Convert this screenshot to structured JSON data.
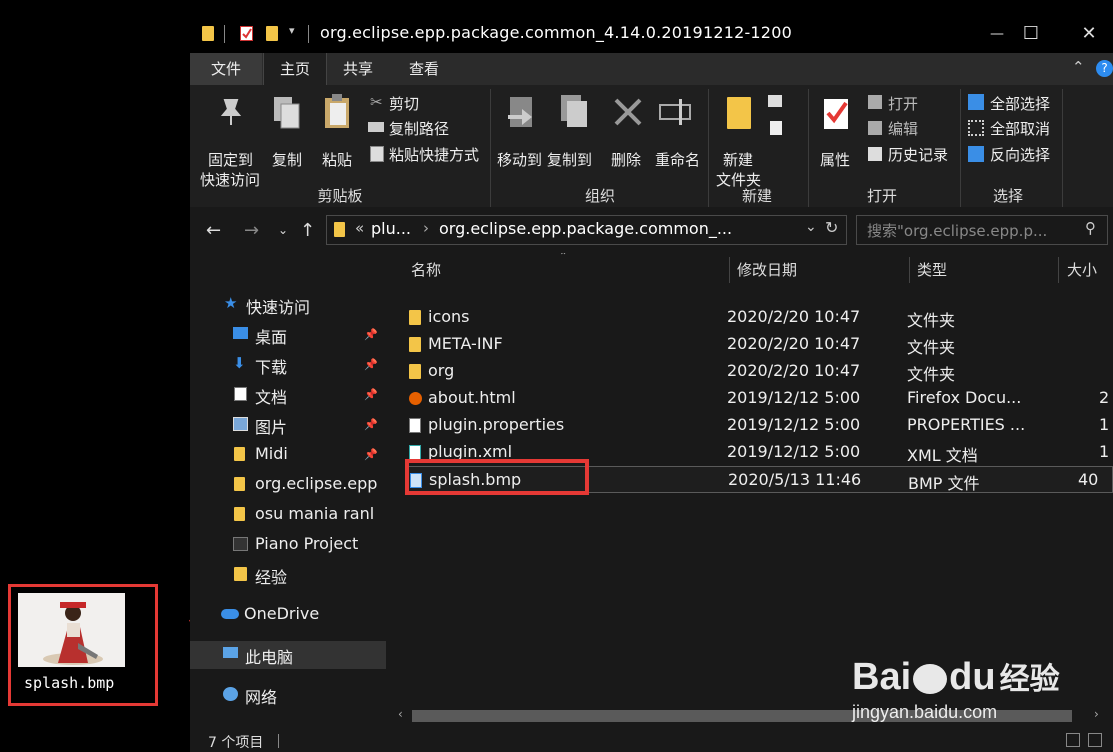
{
  "window": {
    "title": "org.eclipse.epp.package.common_4.14.0.20191212-1200",
    "controls": {
      "minimize": "—",
      "maximize": "☐",
      "close": "✕"
    }
  },
  "tabs": [
    {
      "label": "文件"
    },
    {
      "label": "主页"
    },
    {
      "label": "共享"
    },
    {
      "label": "查看"
    }
  ],
  "ribbon": {
    "clipboard": {
      "pin_line1": "固定到",
      "pin_line2": "快速访问",
      "copy": "复制",
      "paste": "粘贴",
      "cut": "剪切",
      "copy_path": "复制路径",
      "paste_shortcut": "粘贴快捷方式",
      "group": "剪贴板"
    },
    "organize": {
      "move_to": "移动到",
      "copy_to": "复制到",
      "delete": "删除",
      "rename": "重命名",
      "group": "组织"
    },
    "new": {
      "new_folder_line1": "新建",
      "new_folder_line2": "文件夹",
      "group": "新建"
    },
    "open": {
      "properties": "属性",
      "open": "打开",
      "edit": "编辑",
      "history": "历史记录",
      "group": "打开"
    },
    "select": {
      "select_all": "全部选择",
      "select_none": "全部取消",
      "invert": "反向选择",
      "group": "选择"
    }
  },
  "address": {
    "crumb_prefix": "«",
    "crumb1": "plu...",
    "crumb2": "org.eclipse.epp.package.common_...",
    "search_placeholder": "搜索\"org.eclipse.epp.p..."
  },
  "nav": {
    "quick_access": "快速访问",
    "items": [
      {
        "label": "桌面",
        "icon": "desktop-icon"
      },
      {
        "label": "下载",
        "icon": "download-icon"
      },
      {
        "label": "文档",
        "icon": "document-icon"
      },
      {
        "label": "图片",
        "icon": "picture-icon"
      },
      {
        "label": "Midi",
        "icon": "folder-icon"
      },
      {
        "label": "org.eclipse.epp",
        "icon": "folder-icon"
      },
      {
        "label": "osu mania ranl",
        "icon": "folder-icon"
      },
      {
        "label": "Piano Project",
        "icon": "terminal-icon"
      },
      {
        "label": "经验",
        "icon": "folder-icon"
      }
    ],
    "onedrive": "OneDrive",
    "this_pc": "此电脑",
    "network": "网络"
  },
  "columns": {
    "name": "名称",
    "modified": "修改日期",
    "type": "类型",
    "size": "大小"
  },
  "files": [
    {
      "name": "icons",
      "modified": "2020/2/20 10:47",
      "type": "文件夹",
      "size": "",
      "icon": "folder-icon"
    },
    {
      "name": "META-INF",
      "modified": "2020/2/20 10:47",
      "type": "文件夹",
      "size": "",
      "icon": "folder-icon"
    },
    {
      "name": "org",
      "modified": "2020/2/20 10:47",
      "type": "文件夹",
      "size": "",
      "icon": "folder-icon"
    },
    {
      "name": "about.html",
      "modified": "2019/12/12 5:00",
      "type": "Firefox Docu...",
      "size": "2",
      "icon": "firefox-icon"
    },
    {
      "name": "plugin.properties",
      "modified": "2019/12/12 5:00",
      "type": "PROPERTIES ...",
      "size": "1",
      "icon": "file-icon"
    },
    {
      "name": "plugin.xml",
      "modified": "2019/12/12 5:00",
      "type": "XML 文档",
      "size": "1",
      "icon": "xml-icon"
    },
    {
      "name": "splash.bmp",
      "modified": "2020/5/13 11:46",
      "type": "BMP 文件",
      "size": "40",
      "icon": "image-icon"
    }
  ],
  "status": {
    "count": "7 个项目"
  },
  "preview": {
    "label": "splash.bmp"
  },
  "watermark": {
    "brand": "Bai",
    "brand2": "du",
    "cn": "经验",
    "url": "jingyan.baidu.com"
  },
  "colors": {
    "highlight": "#e53935",
    "folder": "#f3c548",
    "accent": "#2d8cf0"
  }
}
